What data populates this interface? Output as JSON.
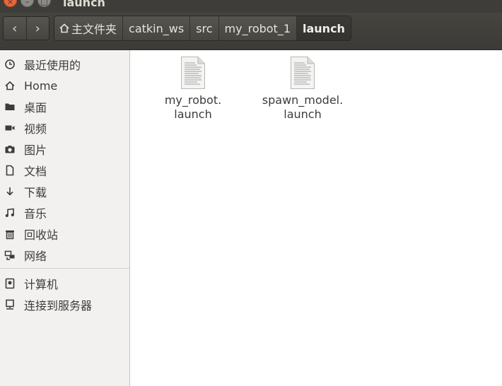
{
  "window": {
    "title": "launch"
  },
  "toolbar": {
    "back_glyph": "‹",
    "forward_glyph": "›",
    "breadcrumbs": [
      {
        "label": "主文件夹",
        "icon": "home-icon"
      },
      {
        "label": "catkin_ws"
      },
      {
        "label": "src"
      },
      {
        "label": "my_robot_1"
      },
      {
        "label": "launch",
        "active": true
      }
    ]
  },
  "sidebar": {
    "places": [
      {
        "label": "最近使用的",
        "icon": "clock-icon"
      },
      {
        "label": "Home",
        "icon": "home-icon"
      },
      {
        "label": "桌面",
        "icon": "folder-icon"
      },
      {
        "label": "视频",
        "icon": "video-icon"
      },
      {
        "label": "图片",
        "icon": "camera-icon"
      },
      {
        "label": "文档",
        "icon": "document-icon"
      },
      {
        "label": "下载",
        "icon": "download-icon"
      },
      {
        "label": "音乐",
        "icon": "music-icon"
      },
      {
        "label": "回收站",
        "icon": "trash-icon"
      },
      {
        "label": "网络",
        "icon": "network-icon"
      }
    ],
    "devices": [
      {
        "label": "计算机",
        "icon": "computer-icon"
      },
      {
        "label": "连接到服务器",
        "icon": "server-icon"
      }
    ]
  },
  "files": [
    {
      "name": "my_robot.\nlaunch",
      "icon": "text-file-icon"
    },
    {
      "name": "spawn_model.\nlaunch",
      "icon": "text-file-icon"
    }
  ],
  "colors": {
    "toolbar_bg": "#3e3d39",
    "close_button": "#e9673a",
    "sidebar_bg": "#f2f1f0"
  }
}
